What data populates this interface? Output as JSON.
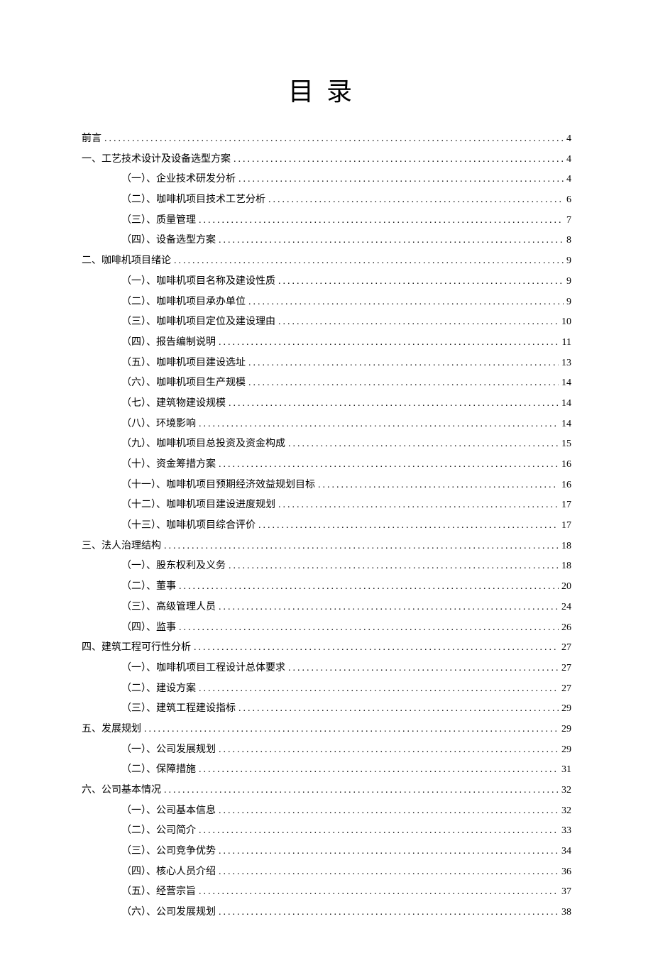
{
  "title": "目录",
  "entries": [
    {
      "label": "前言",
      "page": "4",
      "level": 0
    },
    {
      "label": "一、工艺技术设计及设备选型方案",
      "page": "4",
      "level": 0
    },
    {
      "label": "（一）、企业技术研发分析",
      "page": "4",
      "level": 1
    },
    {
      "label": "（二）、咖啡机项目技术工艺分析",
      "page": "6",
      "level": 1
    },
    {
      "label": "（三）、质量管理",
      "page": "7",
      "level": 1
    },
    {
      "label": "（四）、设备选型方案",
      "page": "8",
      "level": 1
    },
    {
      "label": "二、咖啡机项目绪论",
      "page": "9",
      "level": 0
    },
    {
      "label": "（一）、咖啡机项目名称及建设性质",
      "page": "9",
      "level": 1
    },
    {
      "label": "（二）、咖啡机项目承办单位",
      "page": "9",
      "level": 1
    },
    {
      "label": "（三）、咖啡机项目定位及建设理由",
      "page": "10",
      "level": 1
    },
    {
      "label": "（四）、报告编制说明",
      "page": "11",
      "level": 1
    },
    {
      "label": "（五）、咖啡机项目建设选址",
      "page": "13",
      "level": 1
    },
    {
      "label": "（六）、咖啡机项目生产规模",
      "page": "14",
      "level": 1
    },
    {
      "label": "（七）、建筑物建设规模",
      "page": "14",
      "level": 1
    },
    {
      "label": "（八）、环境影响",
      "page": "14",
      "level": 1
    },
    {
      "label": "（九）、咖啡机项目总投资及资金构成",
      "page": "15",
      "level": 1
    },
    {
      "label": "（十）、资金筹措方案",
      "page": "16",
      "level": 1
    },
    {
      "label": "（十一）、咖啡机项目预期经济效益规划目标",
      "page": "16",
      "level": 1
    },
    {
      "label": "（十二）、咖啡机项目建设进度规划",
      "page": "17",
      "level": 1
    },
    {
      "label": "（十三）、咖啡机项目综合评价",
      "page": "17",
      "level": 1
    },
    {
      "label": "三、法人治理结构",
      "page": "18",
      "level": 0
    },
    {
      "label": "（一）、股东权利及义务",
      "page": "18",
      "level": 1
    },
    {
      "label": "（二）、董事",
      "page": "20",
      "level": 1
    },
    {
      "label": "（三）、高级管理人员",
      "page": "24",
      "level": 1
    },
    {
      "label": "（四）、监事",
      "page": "26",
      "level": 1
    },
    {
      "label": "四、建筑工程可行性分析",
      "page": "27",
      "level": 0
    },
    {
      "label": "（一）、咖啡机项目工程设计总体要求",
      "page": "27",
      "level": 1
    },
    {
      "label": "（二）、建设方案",
      "page": "27",
      "level": 1
    },
    {
      "label": "（三）、建筑工程建设指标",
      "page": "29",
      "level": 1
    },
    {
      "label": "五、发展规划",
      "page": "29",
      "level": 0
    },
    {
      "label": "（一）、公司发展规划",
      "page": "29",
      "level": 1
    },
    {
      "label": "（二）、保障措施",
      "page": "31",
      "level": 1
    },
    {
      "label": "六、公司基本情况",
      "page": "32",
      "level": 0
    },
    {
      "label": "（一）、公司基本信息",
      "page": "32",
      "level": 1
    },
    {
      "label": "（二）、公司简介",
      "page": "33",
      "level": 1
    },
    {
      "label": "（三）、公司竞争优势",
      "page": "34",
      "level": 1
    },
    {
      "label": "（四）、核心人员介绍",
      "page": "36",
      "level": 1
    },
    {
      "label": "（五）、经营宗旨",
      "page": "37",
      "level": 1
    },
    {
      "label": "（六）、公司发展规划",
      "page": "38",
      "level": 1
    }
  ]
}
